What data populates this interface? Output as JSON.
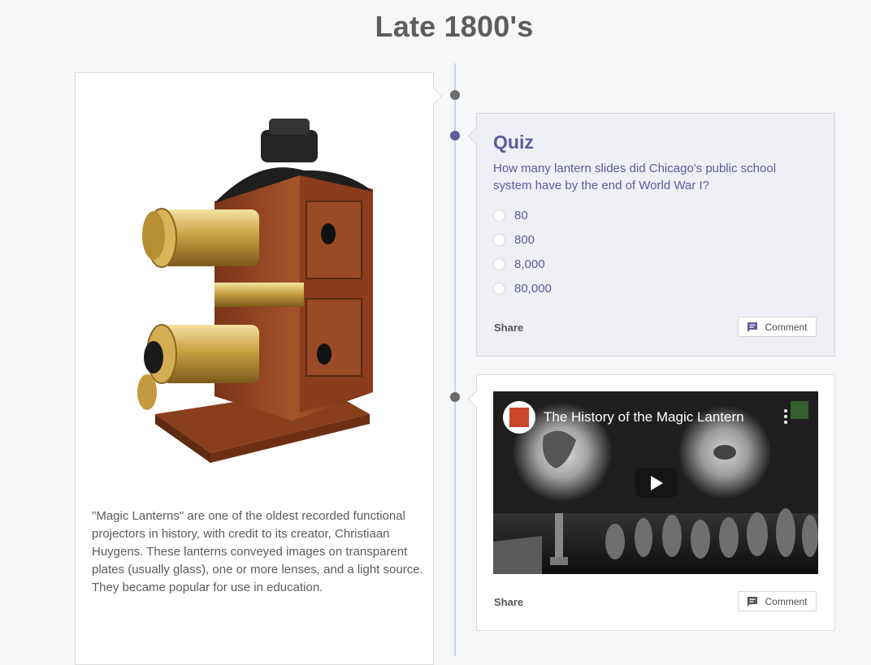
{
  "page": {
    "title": "Late 1800's"
  },
  "left_card": {
    "image_alt": "Magic lantern projector",
    "description": "\"Magic Lanterns\" are one of the oldest recorded functional projectors in history, with credit to its creator, Christiaan Huygens. These lanterns conveyed images on transparent plates (usually glass), one or more lenses, and a light source. They became popular for use in education."
  },
  "quiz": {
    "title": "Quiz",
    "question": "How many lantern slides did Chicago's public school system have by the end of World War I?",
    "options": [
      "80",
      "800",
      "8,000",
      "80,000"
    ],
    "share_label": "Share",
    "comment_label": "Comment"
  },
  "video_card": {
    "video_title": "The History of the Magic Lantern",
    "share_label": "Share",
    "comment_label": "Comment"
  },
  "colors": {
    "accent": "#5e5a9b",
    "timeline": "#c7d3ec",
    "background": "#f6f7f9"
  }
}
